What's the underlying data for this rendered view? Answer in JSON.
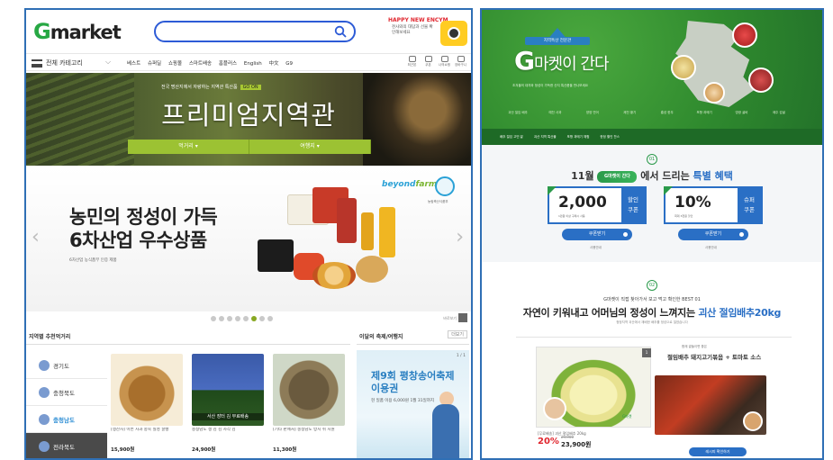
{
  "left": {
    "logo": {
      "g": "G",
      "rest": "market"
    },
    "search": {
      "placeholder": ""
    },
    "promo": {
      "title": "HAPPY NEW ENCYM",
      "sub": "천사와의 대답과 선물 확인해보세요"
    },
    "nav": {
      "category_label": "전체 카테고리",
      "links": [
        "베스트",
        "슈퍼딜",
        "쇼핑몰",
        "스마트배송",
        "홈플러스",
        "English",
        "中文",
        "G9"
      ],
      "utility": [
        "최근본",
        "쿠폰",
        "나의쇼핑",
        "장바구니"
      ]
    },
    "hero": {
      "caption": "전국 명산지에서 자랑하는 지역관 특산품",
      "badge": "GO ON",
      "title": "프리미엄지역관",
      "tabs": [
        "먹거리 ▾",
        "여행지 ▾"
      ]
    },
    "banner": {
      "title_line1": "농민의 정성이 가득",
      "title_line2": "6차산업 우수상품",
      "subtitle": "6차산업 농식품부 인증 제품",
      "brand_a": "beyond",
      "brand_b": "farm",
      "seal_caption": "농림축산식품부"
    },
    "dots_count": 8,
    "dots_active": 5,
    "dots_extra": "바로보기",
    "section_local": {
      "title": "지역별 추천먹거리"
    },
    "section_event": {
      "title": "이달의 축제/여행지",
      "more": "더보기"
    },
    "regions": [
      {
        "name": "경기도",
        "style": "normal"
      },
      {
        "name": "충청북도",
        "style": "normal"
      },
      {
        "name": "충청남도",
        "style": "selected"
      },
      {
        "name": "전라북도",
        "style": "dark"
      }
    ],
    "items": [
      {
        "desc": "[생산자] 이번 사과 충북 칠성 꿀빵",
        "price": "15,900원"
      },
      {
        "desc": "충청남도 생 김 김 사각 김",
        "price": "24,900원",
        "caption": "서산 장터 김 무료배송"
      },
      {
        "desc": "[기타 판매처] 충청남도 방지 취 지원",
        "price": "11,300원"
      }
    ],
    "festival": {
      "page": "1 / 1",
      "title_line1": "제9회 평창송어축제",
      "title_line2": "이용권",
      "info": "현 일품 이용 6,000원 1월 31일까지"
    }
  },
  "right": {
    "badge": "지역특산 전문관",
    "title_g": "G",
    "title_rest": "마켓이 간다",
    "desc": "초겨울의 대지와 정성이 가득한 산지 특산품을 만나보세요",
    "region_links": [
      "괴산 절임 배추",
      "예천 사과",
      "양양 연어",
      "제천 황기",
      "홍성 한우",
      "포항 과메기",
      "영광 굴비",
      "제주 감귤"
    ],
    "strip": [
      "배추 절임 고민 끝",
      "괴산 지역 특산물",
      "포항 과메기 체험",
      "한정 할인 찬스"
    ],
    "coupon_num": "01",
    "coupon_head_pre": "11월",
    "coupon_head_mini": "G마켓이 간다",
    "coupon_head_mid": " 에서 드리는 ",
    "coupon_head_hl": "특별 혜택",
    "coupons": [
      {
        "amount": "2,000",
        "side_line1": "할인",
        "side_line2": "쿠폰",
        "caption": "1만원 이상 구매시 사용",
        "button": "쿠폰받기",
        "note": "사용안내"
      },
      {
        "amount": "10%",
        "side_line1": "슈퍼",
        "side_line2": "쿠폰",
        "caption": "최대 3천원 할인",
        "button": "쿠폰받기",
        "note": "사용안내"
      }
    ],
    "best_num": "02",
    "best_sub": "G마켓이 직접 찾아가서 보고 먹고 확인한 BEST 01",
    "best_title_pre": "자연이 키워내고 어머님의 정성이 느껴지는 ",
    "best_title_hl": "괴산 절임배추20kg",
    "best_desc": "청정지역 괴산에서 재배한 배추를 정성으로 절였습니다",
    "card": {
      "num": "1",
      "gtag": "G마켓",
      "prodname": "[무료배송] 괴산 절임배추 20kg",
      "discount": "20%",
      "orig_price": "29,900",
      "price": "23,900원",
      "tag2": "함께 곁들이면 좋은",
      "title2": "절임배추 돼지고기볶음 + 토마토 소스",
      "button2": "레시피 확인하기"
    }
  }
}
